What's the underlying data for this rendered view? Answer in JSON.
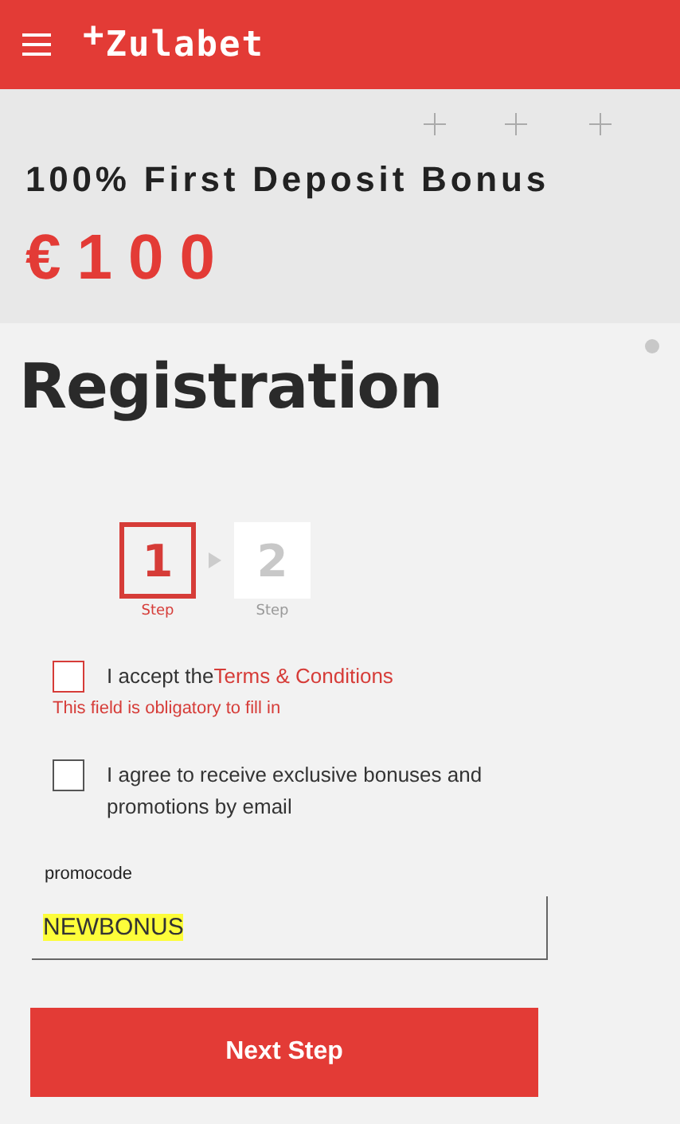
{
  "header": {
    "logo": "$^{+}$Zulabet"
  },
  "banner": {
    "title": "100% First Deposit Bonus",
    "amount": "€100"
  },
  "page_title": "Registration",
  "steps": [
    {
      "number": "1",
      "label": "Step",
      "selected": true
    },
    {
      "number": "2",
      "label": "Step",
      "selected": false
    }
  ],
  "consents": [
    {
      "text": "I accept the",
      "link": "Terms & Conditions",
      "checked": false,
      "error": "This field is obligatory to fill in"
    },
    {
      "text": "I agree to receive exclusive bonuses and promotions by email",
      "checked": false
    }
  ],
  "promocode": {
    "label": "promocode",
    "value": "NEWBONUS"
  },
  "next_button": "Next Step"
}
